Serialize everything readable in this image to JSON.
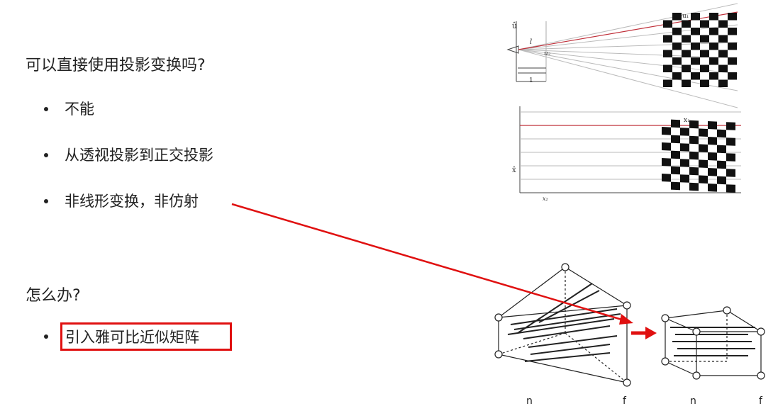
{
  "heading1": "可以直接使用投影变换吗?",
  "bullets1": [
    "不能",
    "从透视投影到正交投影",
    "非线形变换，非仿射"
  ],
  "heading2": "怎么办?",
  "bullets2": [
    "引入雅可比近似矩阵"
  ],
  "top_figure": {
    "axis_u_hat": "û",
    "label_l": "l",
    "label_u2": "u₂",
    "label_1": "1",
    "label_u1": "u₁"
  },
  "mid_figure": {
    "axis_x_hat": "x̂",
    "label_x2": "x₂",
    "label_x1": "x₁"
  },
  "frustum_figure": {
    "labels": [
      "n",
      "f",
      "n",
      "f"
    ]
  },
  "colors": {
    "accent_red": "#e01010",
    "text": "#222222"
  }
}
